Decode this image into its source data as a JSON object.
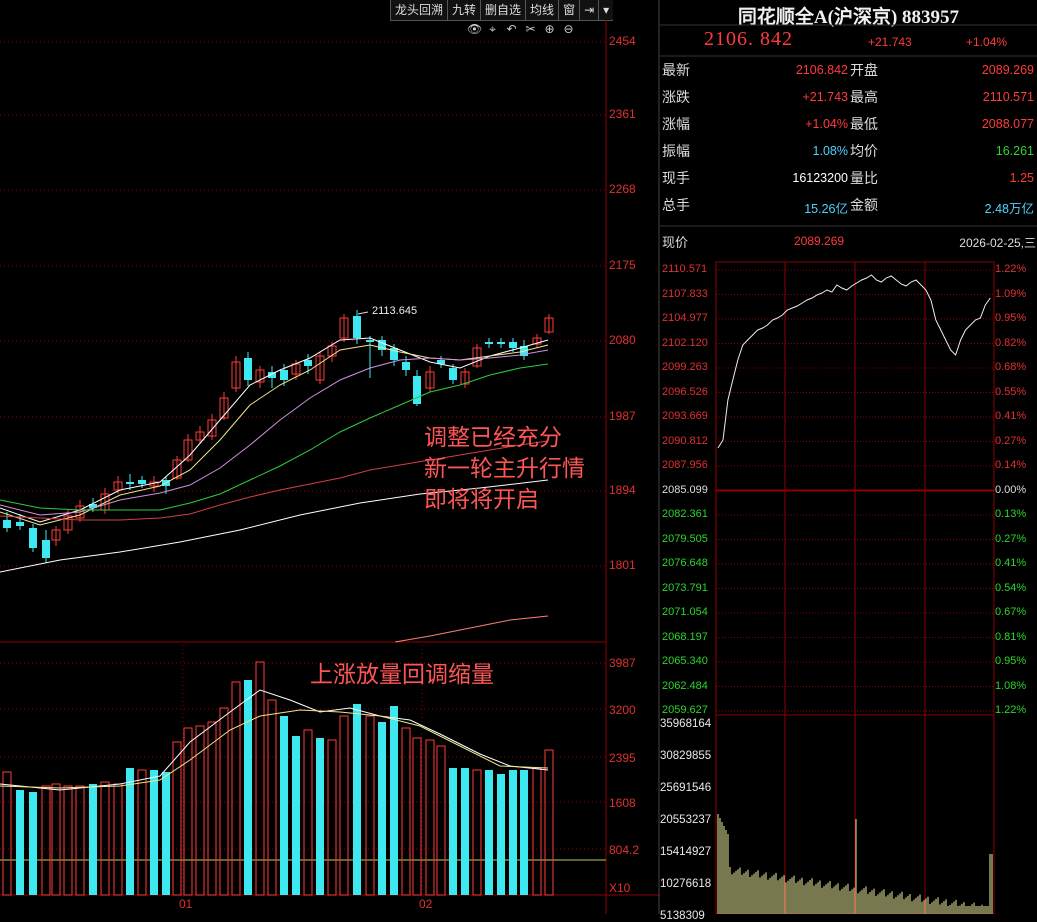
{
  "toolbar": {
    "buttons": [
      "龙头回溯",
      "九转",
      "删自选",
      "均线",
      "窗",
      "⇥",
      "▾"
    ],
    "icons": [
      "eye-icon",
      "crosshair-icon",
      "undo-icon",
      "scissors-icon",
      "zoom-in-icon",
      "zoom-out-icon"
    ]
  },
  "kline": {
    "price_axis": [
      "2454",
      "2361",
      "2268",
      "2175",
      "2080",
      "1987",
      "1894",
      "1801"
    ],
    "high_label": "2113.645",
    "annotation": [
      "调整已经充分",
      "新一轮主升行情",
      "即将将开启"
    ],
    "volume_annotation": "上涨放量回调缩量",
    "volume_axis": [
      "3987",
      "3200",
      "2395",
      "1608",
      "804.2",
      "X10"
    ],
    "date_labels": [
      "01",
      "02"
    ]
  },
  "quote": {
    "title": "同花顺全A(沪深京) 883957",
    "price": "2106. 842",
    "change": "+21.743",
    "change_pct": "+1.04%",
    "rows": [
      {
        "l1": "最新",
        "v1": "2106.842",
        "c1": "red",
        "l2": "开盘",
        "v2": "2089.269",
        "c2": "red"
      },
      {
        "l1": "涨跌",
        "v1": "+21.743",
        "c1": "red",
        "l2": "最高",
        "v2": "2110.571",
        "c2": "red"
      },
      {
        "l1": "涨幅",
        "v1": "+1.04%",
        "c1": "red",
        "l2": "最低",
        "v2": "2088.077",
        "c2": "red"
      },
      {
        "l1": "振幅",
        "v1": "1.08%",
        "c1": "cyan",
        "l2": "均价",
        "v2": "16.261",
        "c2": "green"
      },
      {
        "l1": "现手",
        "v1": "16123200",
        "c1": "white",
        "l2": "量比",
        "v2": "1.25",
        "c2": "red"
      },
      {
        "l1": "总手",
        "v1": "15.26亿",
        "c1": "cyan",
        "l2": "金额",
        "v2": "2.48万亿",
        "c2": "cyan"
      }
    ]
  },
  "intraday": {
    "label": "现价",
    "price": "2089.269",
    "date": "2026-02-25,三",
    "price_ticks": [
      "2110.571",
      "2107.833",
      "2104.977",
      "2102.120",
      "2099.263",
      "2096.526",
      "2093.669",
      "2090.812",
      "2087.956",
      "2085.099",
      "2082.361",
      "2079.505",
      "2076.648",
      "2073.791",
      "2071.054",
      "2068.197",
      "2065.340",
      "2062.484",
      "2059.627"
    ],
    "pct_ticks": [
      "1.22%",
      "1.09%",
      "0.95%",
      "0.82%",
      "0.68%",
      "0.55%",
      "0.41%",
      "0.27%",
      "0.14%",
      "0.00%",
      "0.13%",
      "0.27%",
      "0.41%",
      "0.54%",
      "0.67%",
      "0.81%",
      "0.95%",
      "1.08%",
      "1.22%"
    ],
    "volume_ticks": [
      "35968164",
      "30829855",
      "25691546",
      "20553237",
      "15414927",
      "10276618",
      "5138309"
    ]
  },
  "colors": {
    "up": "#ff3b3b",
    "down": "#3ee8f0",
    "grid": "#8b0000",
    "ma5": "#ffffff",
    "ma10": "#f0e68c",
    "ma20": "#d090e0",
    "ma30": "#2ecc40",
    "ma60": "#d04040",
    "ma120": "#ffffff"
  }
}
